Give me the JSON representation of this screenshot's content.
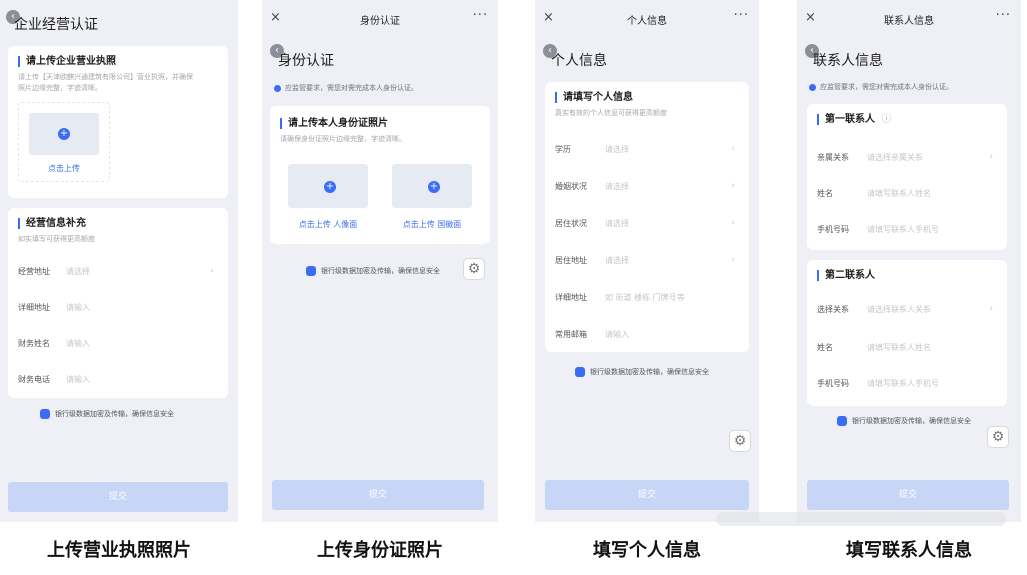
{
  "screens": [
    {
      "title": "企业经营认证",
      "license_section": {
        "heading": "请上传企业营业执照",
        "hint_line1": "请上传【天津欧麒兴通建筑有限公司】营业执照，并确保",
        "hint_line2": "照片边缘完整，字迹清晰。",
        "upload_label": "点击上传"
      },
      "business_section": {
        "heading": "经营信息补充",
        "hint": "如实填写可获得更高额度",
        "rows": [
          {
            "label": "经营地址",
            "placeholder": "请选择",
            "chevron": "›"
          },
          {
            "label": "详细地址",
            "placeholder": "请输入",
            "chevron": ""
          },
          {
            "label": "财务姓名",
            "placeholder": "请输入",
            "chevron": ""
          },
          {
            "label": "财务电话",
            "placeholder": "请输入",
            "chevron": ""
          }
        ]
      },
      "secure_text": "银行级数据加密及传输，确保信息安全",
      "submit_label": "提交",
      "caption": "上传营业执照照片"
    },
    {
      "nav_title": "身份认证",
      "title": "身份认证",
      "notice": "应监管要求，需您对需完成本人身份认证。",
      "id_section": {
        "heading": "请上传本人身份证照片",
        "hint": "请确保身份证照片边缘完整，字迹清晰。",
        "front_label": "点击上传 人像面",
        "back_label": "点击上传 国徽面"
      },
      "secure_text": "银行级数据加密及传输，确保信息安全",
      "submit_label": "提交",
      "caption": "上传身份证照片"
    },
    {
      "nav_title": "个人信息",
      "title": "个人信息",
      "section": {
        "heading": "请填写个人信息",
        "hint": "真实有效的个人信息可获得更高额度",
        "rows": [
          {
            "label": "学历",
            "placeholder": "请选择",
            "chevron": "›"
          },
          {
            "label": "婚姻状况",
            "placeholder": "请选择",
            "chevron": "›"
          },
          {
            "label": "居住状况",
            "placeholder": "请选择",
            "chevron": "›"
          },
          {
            "label": "居住地址",
            "placeholder": "请选择",
            "chevron": "›"
          },
          {
            "label": "详细地址",
            "placeholder": "如  街道  楼栋  门牌号等",
            "chevron": ""
          },
          {
            "label": "常用邮箱",
            "placeholder": "请输入",
            "chevron": ""
          }
        ]
      },
      "secure_text": "银行级数据加密及传输，确保信息安全",
      "submit_label": "提交",
      "caption": "填写个人信息"
    },
    {
      "nav_title": "联系人信息",
      "title": "联系人信息",
      "notice": "应监管要求，需您对需完成本人身份认证。",
      "contact1": {
        "heading": "第一联系人",
        "rows": [
          {
            "label": "亲属关系",
            "placeholder": "请选择亲属关系",
            "chevron": "›"
          },
          {
            "label": "姓名",
            "placeholder": "请填写联系人姓名",
            "chevron": ""
          },
          {
            "label": "手机号码",
            "placeholder": "请填写联系人手机号",
            "chevron": ""
          }
        ]
      },
      "contact2": {
        "heading": "第二联系人",
        "rows": [
          {
            "label": "选择关系",
            "placeholder": "请选择联系人关系",
            "chevron": "›"
          },
          {
            "label": "姓名",
            "placeholder": "请填写联系人姓名",
            "chevron": ""
          },
          {
            "label": "手机号码",
            "placeholder": "请填写联系人手机号",
            "chevron": ""
          }
        ]
      },
      "secure_text": "银行级数据加密及传输，确保信息安全",
      "submit_label": "提交",
      "caption": "填写联系人信息"
    }
  ],
  "icons": {
    "close": "×",
    "more": "···",
    "back": "‹",
    "plus": "+",
    "gear": "⚙",
    "info_circle": "ⓘ"
  },
  "colors": {
    "accent": "#3b6cf6",
    "submit_disabled": "#c7d5f7",
    "screen_bg": "#eef0f6"
  }
}
